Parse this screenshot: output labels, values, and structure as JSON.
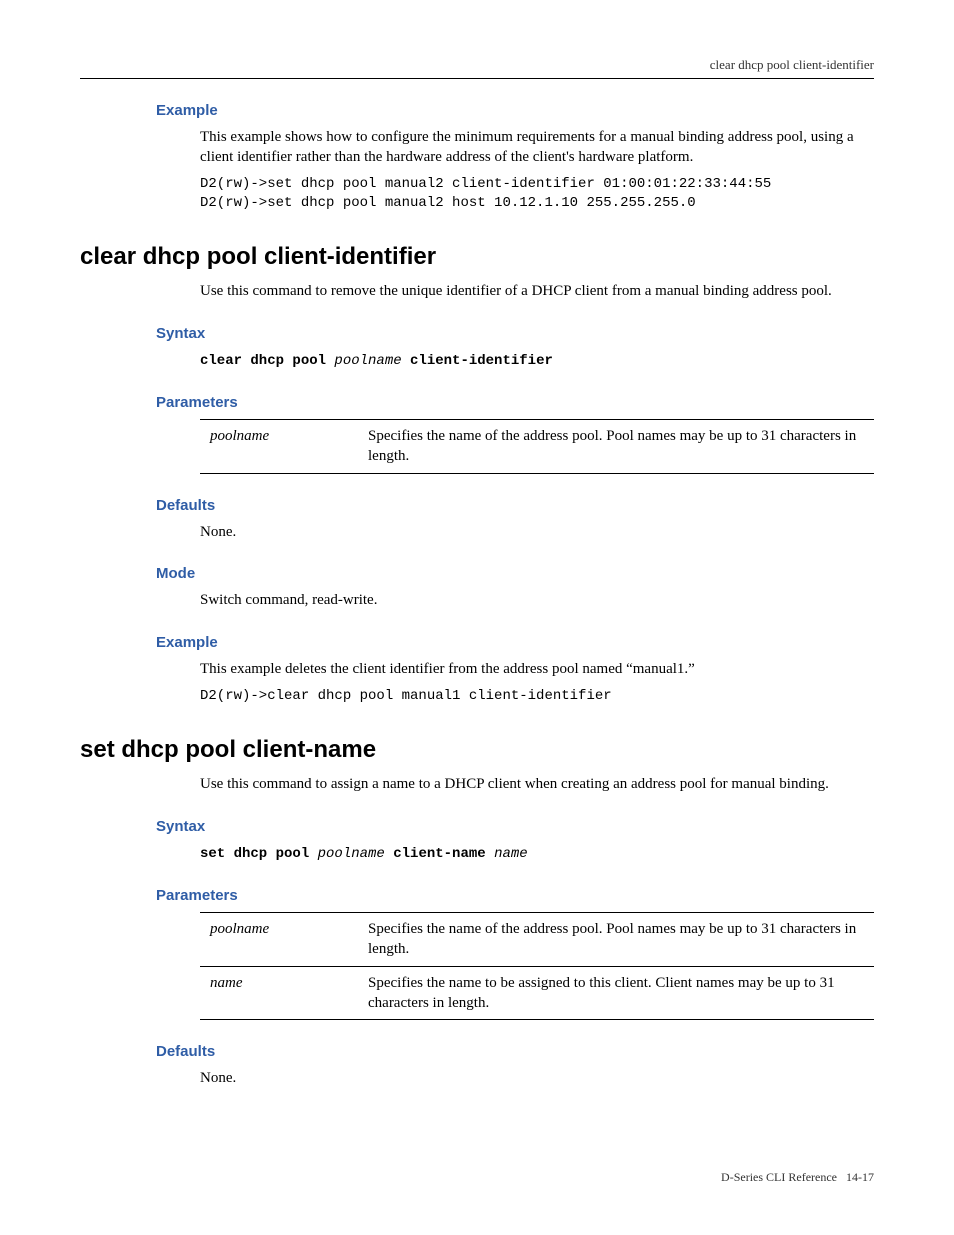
{
  "header": {
    "reference": "clear dhcp pool client-identifier"
  },
  "example0": {
    "label": "Example",
    "body": "This example shows how to configure the minimum requirements for a manual binding address pool, using a client identifier rather than the hardware address of the client's hardware platform.",
    "code": "D2(rw)->set dhcp pool manual2 client-identifier 01:00:01:22:33:44:55\nD2(rw)->set dhcp pool manual2 host 10.12.1.10 255.255.255.0"
  },
  "cmd1": {
    "title": "clear dhcp pool client-identifier",
    "intro": "Use this command to remove the unique identifier of a DHCP client from a manual binding address pool.",
    "syntax_label": "Syntax",
    "syntax_b1": "clear dhcp pool ",
    "syntax_i1": "poolname",
    "syntax_b2": " client-identifier",
    "parameters_label": "Parameters",
    "params": [
      {
        "name": "poolname",
        "desc": "Specifies the name of the address pool. Pool names may be up to 31 characters in length."
      }
    ],
    "defaults_label": "Defaults",
    "defaults_body": "None.",
    "mode_label": "Mode",
    "mode_body": "Switch command, read-write.",
    "example_label": "Example",
    "example_body": "This example deletes the client identifier from the address pool named “manual1.”",
    "example_code": "D2(rw)->clear dhcp pool manual1 client-identifier"
  },
  "cmd2": {
    "title": "set dhcp pool client-name",
    "intro": "Use this command to assign a name to a DHCP client when creating an address pool for manual binding.",
    "syntax_label": "Syntax",
    "syntax_b1": "set dhcp pool ",
    "syntax_i1": "poolname",
    "syntax_b2": " client-name ",
    "syntax_i2": "name",
    "parameters_label": "Parameters",
    "params": [
      {
        "name": "poolname",
        "desc": "Specifies the name of the address pool. Pool names may be up to 31 characters in length."
      },
      {
        "name": "name",
        "desc": "Specifies the name to be assigned to this client. Client names may be up to 31 characters in length."
      }
    ],
    "defaults_label": "Defaults",
    "defaults_body": "None."
  },
  "footer": {
    "booktitle": "D-Series CLI Reference",
    "pagenum": "14-17"
  }
}
